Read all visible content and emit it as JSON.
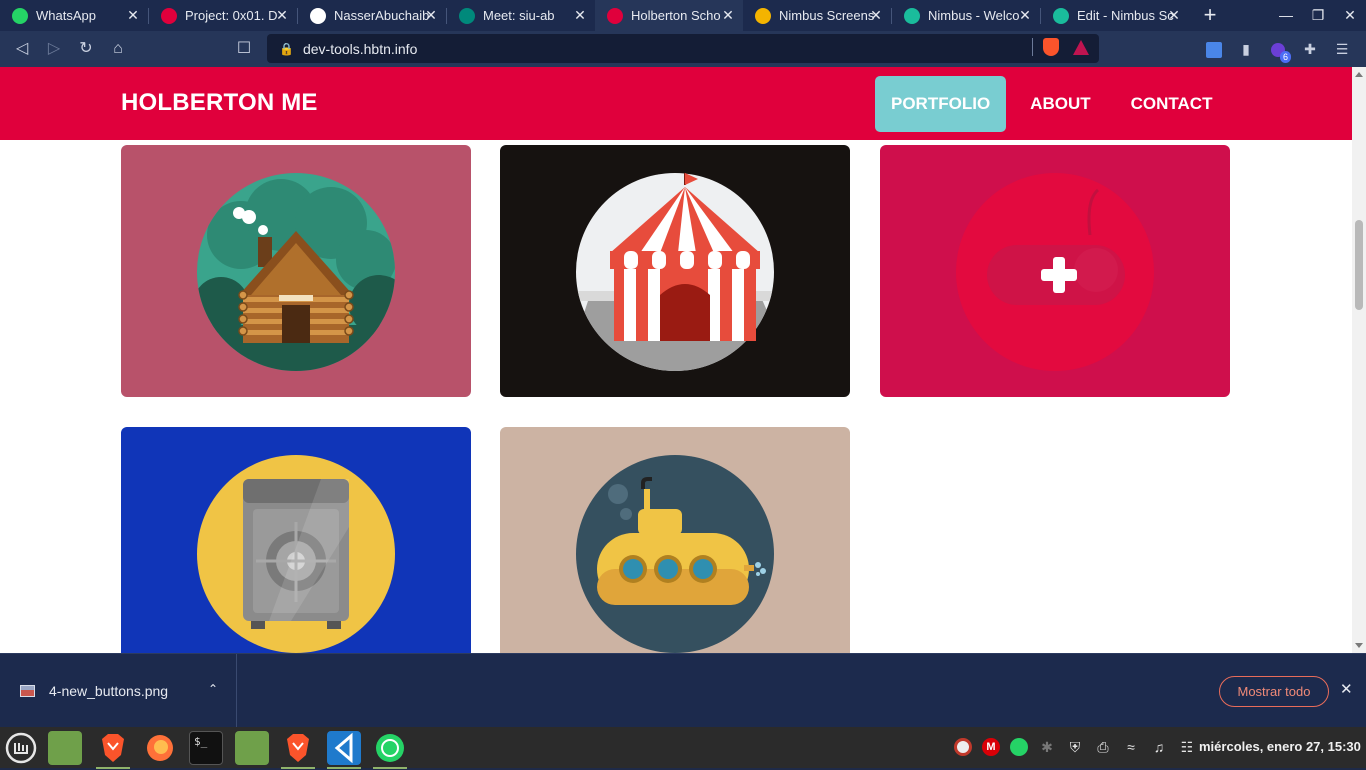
{
  "browser": {
    "tabs": [
      {
        "title": "WhatsApp",
        "icon": "whatsapp-icon",
        "color": "#25d366",
        "active": false
      },
      {
        "title": "Project: 0x01. D",
        "icon": "holberton-icon",
        "color": "#e0003c",
        "active": false
      },
      {
        "title": "NasserAbuchaib",
        "icon": "github-icon",
        "color": "#ffffff",
        "active": false
      },
      {
        "title": "Meet: siu-ab",
        "icon": "meet-icon",
        "color": "#00897b",
        "active": false
      },
      {
        "title": "Holberton Scho",
        "icon": "holberton-icon",
        "color": "#e0003c",
        "active": true
      },
      {
        "title": "Nimbus Screens",
        "icon": "nimbus-icon",
        "color": "#f4b400",
        "active": false
      },
      {
        "title": "Nimbus - Welco",
        "icon": "nimbus-icon",
        "color": "#1abc9c",
        "active": false
      },
      {
        "title": "Edit - Nimbus Sc",
        "icon": "nimbus-edit-icon",
        "color": "#1abc9c",
        "active": false
      }
    ],
    "new_tab": "+",
    "url": "dev-tools.hbtn.info"
  },
  "site": {
    "brand": "HOLBERTON ME",
    "nav": [
      {
        "label": "PORTFOLIO",
        "active": true
      },
      {
        "label": "ABOUT",
        "active": false
      },
      {
        "label": "CONTACT",
        "active": false
      }
    ],
    "portfolio": [
      {
        "name": "log-cabin",
        "bg": "#b8526a"
      },
      {
        "name": "circus-tent",
        "bg": "#161210"
      },
      {
        "name": "game-controller",
        "bg": "#cf0f4c",
        "hover_label": "+"
      },
      {
        "name": "safe",
        "bg": "#1035b8"
      },
      {
        "name": "submarine",
        "bg": "#ccb3a3"
      }
    ]
  },
  "downloads": {
    "file_name": "4-new_buttons.png",
    "show_all_label": "Mostrar todo"
  },
  "taskbar": {
    "clock": "miércoles, enero 27, 15:30"
  }
}
